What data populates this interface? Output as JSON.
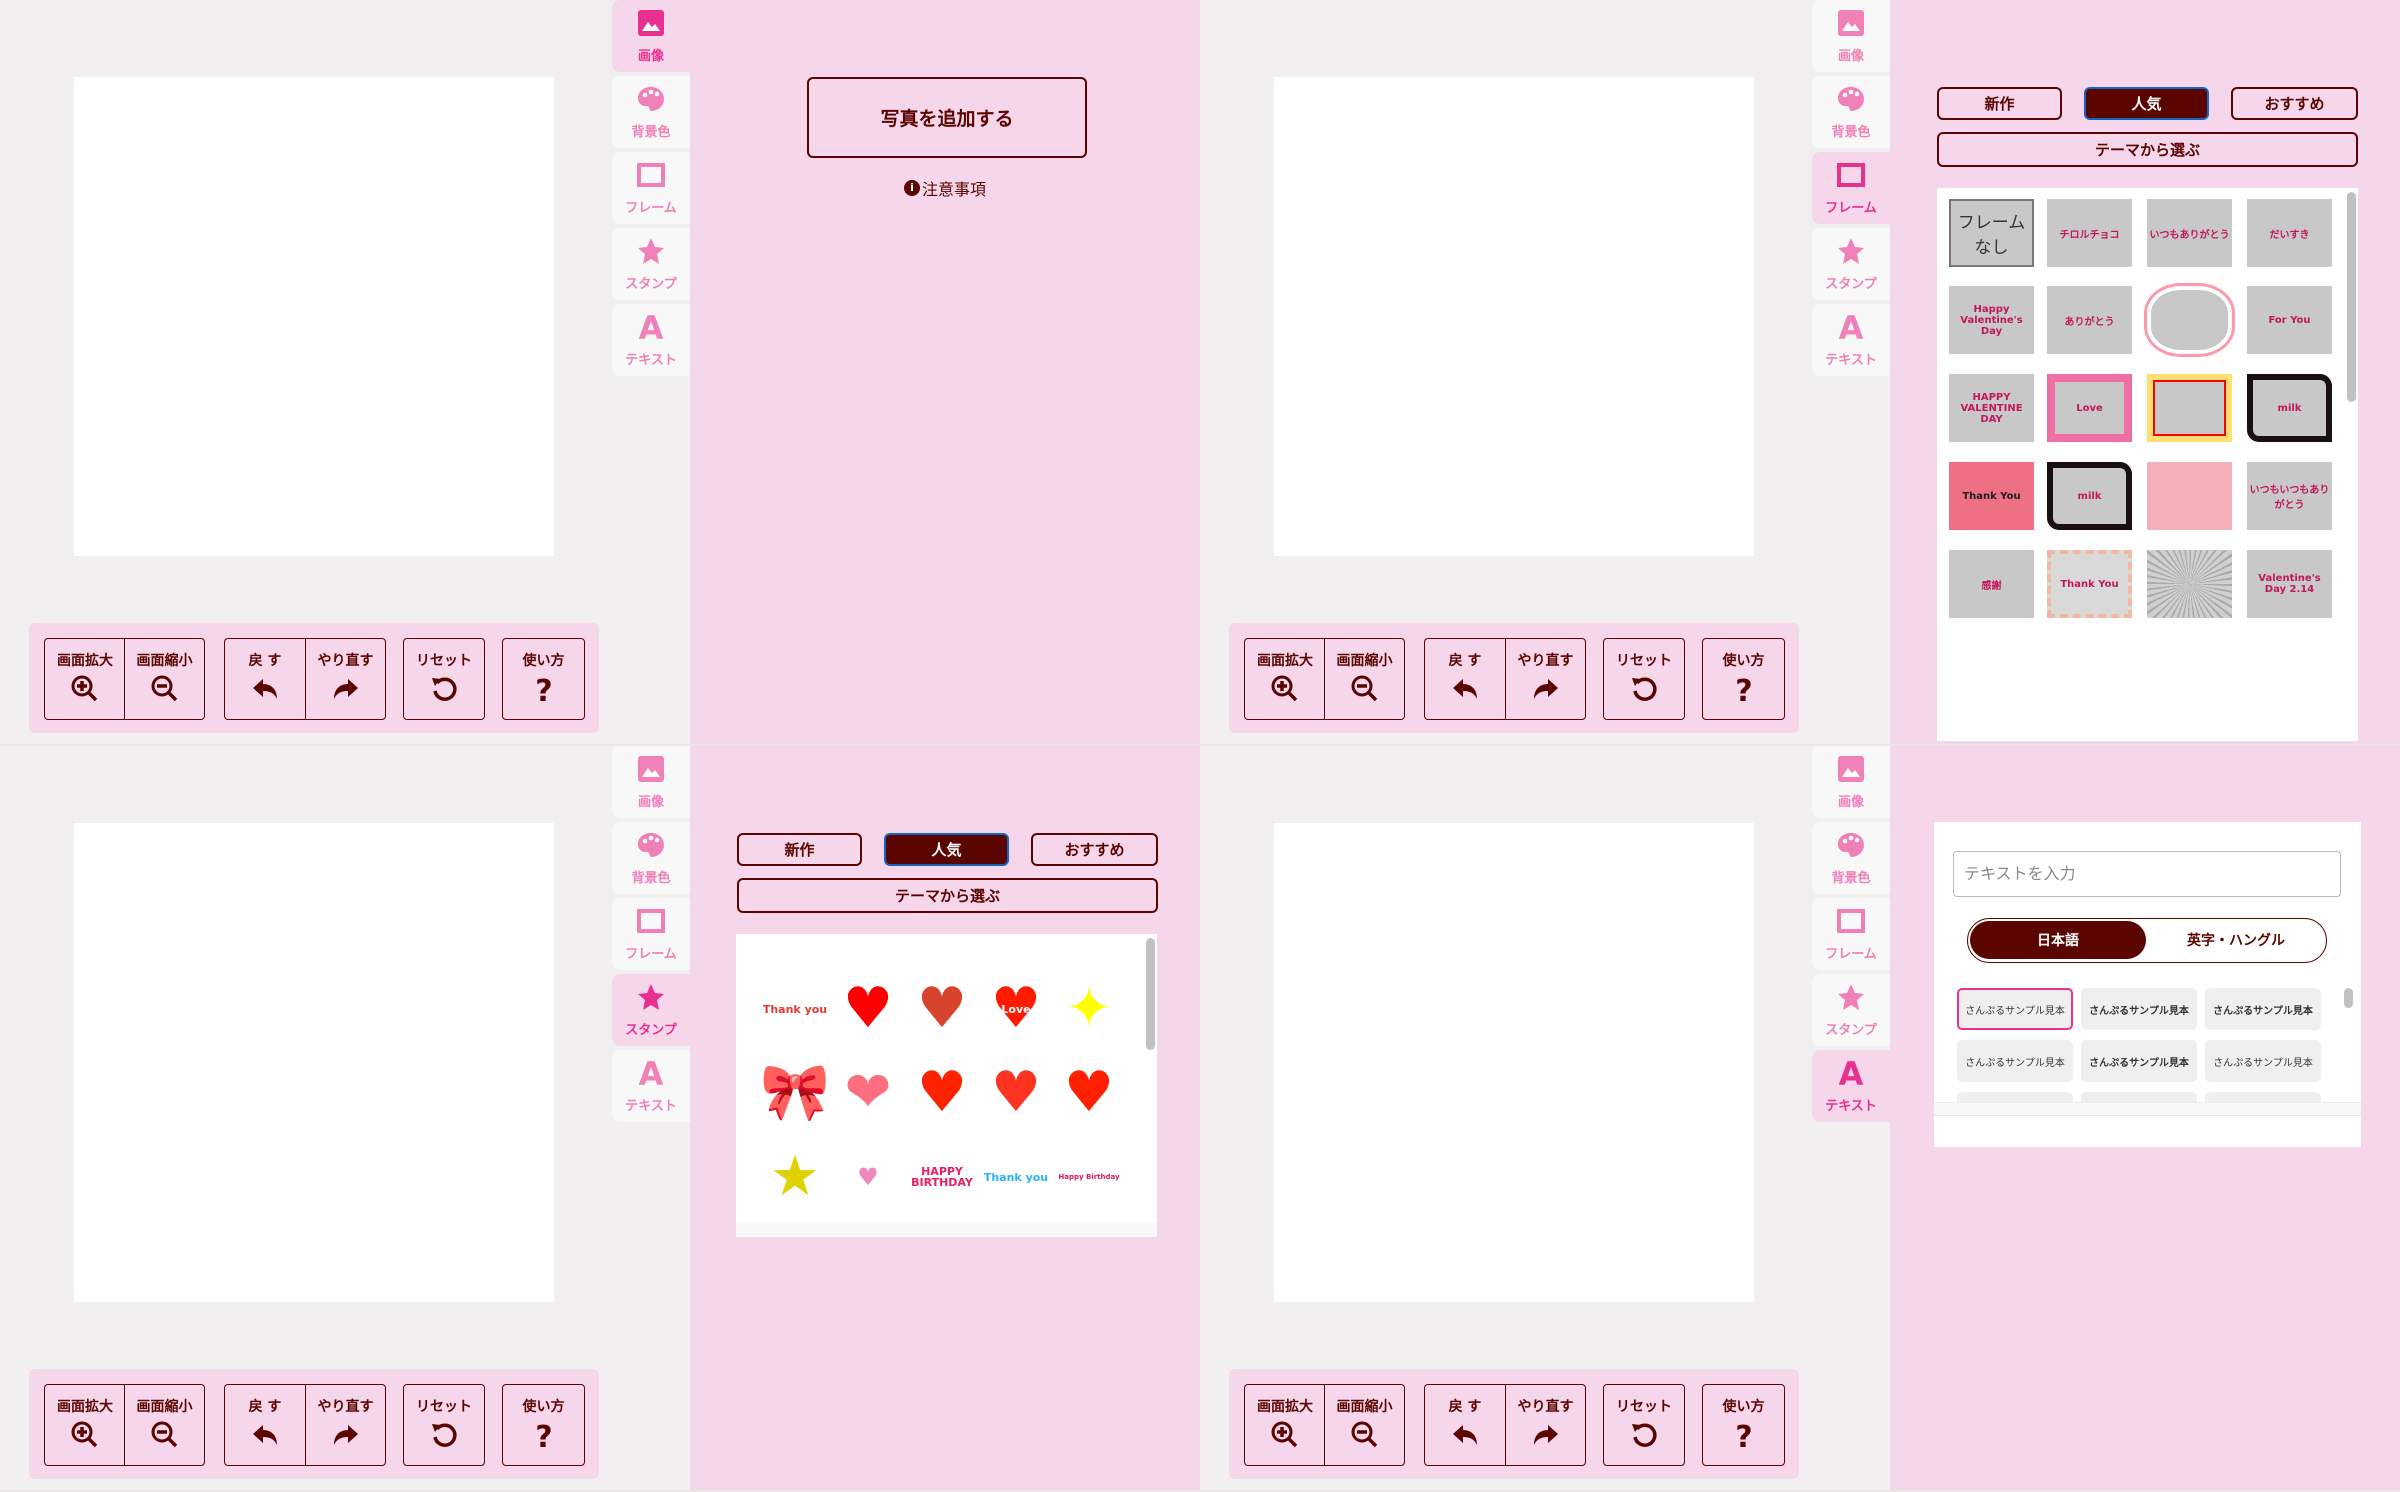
{
  "colors": {
    "brand": "#5a0500",
    "panel_bg": "#f6d6ea",
    "stage_bg": "#f1eff0",
    "tab_icon": "#f080b8",
    "tab_icon_active": "#e8318f",
    "selected_border": "#1565c0"
  },
  "sidebar": {
    "items": [
      {
        "label": "画像",
        "icon": "image-icon"
      },
      {
        "label": "背景色",
        "icon": "palette-icon"
      },
      {
        "label": "フレーム",
        "icon": "frame-icon"
      },
      {
        "label": "スタンプ",
        "icon": "star-icon"
      },
      {
        "label": "テキスト",
        "icon": "text-a-icon"
      }
    ]
  },
  "toolbar": {
    "buttons": [
      {
        "label": "画面拡大",
        "icon": "zoom-in-icon"
      },
      {
        "label": "画面縮小",
        "icon": "zoom-out-icon"
      },
      {
        "label": "戻 す",
        "icon": "undo-icon"
      },
      {
        "label": "やり直す",
        "icon": "redo-icon"
      },
      {
        "label": "リセット",
        "icon": "reset-icon"
      },
      {
        "label": "使い方",
        "icon": "help-icon"
      }
    ]
  },
  "screens": [
    {
      "active_tab": 0
    },
    {
      "active_tab": 2
    },
    {
      "active_tab": 3
    },
    {
      "active_tab": 4
    }
  ],
  "image_panel": {
    "add_photo": "写真を追加する",
    "notes": "注意事項",
    "notes_icon": "info-icon"
  },
  "filter_tabs": {
    "items": [
      "新作",
      "人気",
      "おすすめ"
    ],
    "selected": 1,
    "theme": "テーマから選ぶ"
  },
  "frames": [
    {
      "label": "フレーム なし",
      "style": "none"
    },
    {
      "label": "チロルチョコ",
      "style": "plain"
    },
    {
      "label": "いつもありがとう",
      "style": "plain"
    },
    {
      "label": "だいすき",
      "style": "plain"
    },
    {
      "label": "Happy Valentine's Day",
      "style": "plain"
    },
    {
      "label": "ありがとう",
      "style": "plain"
    },
    {
      "label": "",
      "style": "hearts"
    },
    {
      "label": "For You",
      "style": "plain"
    },
    {
      "label": "HAPPY VALENTINE DAY",
      "style": "plain"
    },
    {
      "label": "Love",
      "style": "stripe"
    },
    {
      "label": "",
      "style": "yellow"
    },
    {
      "label": "milk",
      "style": "cow"
    },
    {
      "label": "Thank You",
      "style": "pinkheart"
    },
    {
      "label": "milk",
      "style": "cow"
    },
    {
      "label": "",
      "style": "pinkbear"
    },
    {
      "label": "いつもいつもありがとう",
      "style": "plain"
    },
    {
      "label": "感謝",
      "style": "plain"
    },
    {
      "label": "Thank You",
      "style": "stripe2"
    },
    {
      "label": "",
      "style": "rays"
    },
    {
      "label": "Valentine's Day 2.14",
      "style": "plain"
    }
  ],
  "stamps": [
    {
      "label": "Thank you",
      "kind": "text",
      "color": "#e53935"
    },
    {
      "label": "♥",
      "kind": "glyph",
      "color": "#ff0000"
    },
    {
      "label": "♥",
      "kind": "glyph",
      "color": "#d8432e"
    },
    {
      "label": "Love",
      "kind": "heart-text",
      "color": "#ff1a00"
    },
    {
      "label": "✦",
      "kind": "glyph",
      "color": "#ffff00"
    },
    {
      "label": "🎀",
      "kind": "glyph",
      "color": "#cc0000"
    },
    {
      "label": "❤",
      "kind": "glyph",
      "color": "#ff6f7f"
    },
    {
      "label": "♥",
      "kind": "glyph",
      "color": "#ff2200"
    },
    {
      "label": "♥",
      "kind": "glyph",
      "color": "#ff3322"
    },
    {
      "label": "♥",
      "kind": "glyph",
      "color": "#ff2000"
    },
    {
      "label": "★",
      "kind": "glyph",
      "color": "#e0d000"
    },
    {
      "label": "♥",
      "kind": "small-glyph",
      "color": "#ee88bb"
    },
    {
      "label": "HAPPY BIRTHDAY",
      "kind": "text",
      "color": "#e91e63"
    },
    {
      "label": "Thank you",
      "kind": "text",
      "color": "#29b6f6"
    },
    {
      "label": "Happy Birthday",
      "kind": "small-text",
      "color": "#d81b60"
    }
  ],
  "text_panel": {
    "placeholder": "テキストを入力",
    "languages": [
      "日本語",
      "英字・ハングル"
    ],
    "selected_language": 0,
    "font_samples": [
      "さんぷるサンプル見本",
      "さんぷるサンプル見本",
      "さんぷるサンプル見本",
      "さんぷるサンプル見本",
      "さんぷるサンプル見本",
      "さんぷるサンプル見本"
    ],
    "selected_font": 0
  }
}
